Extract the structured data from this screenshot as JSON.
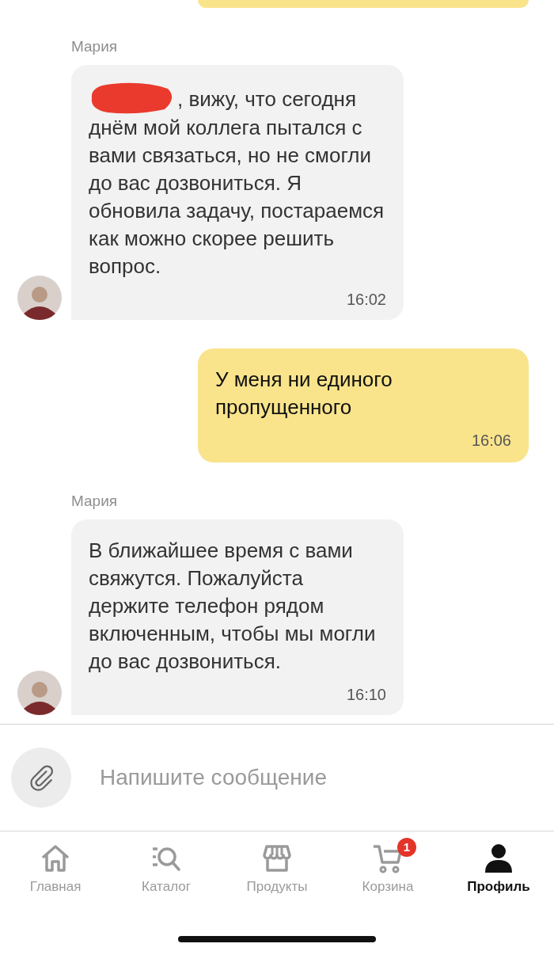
{
  "messages": [
    {
      "kind": "outgoing_cut"
    },
    {
      "kind": "incoming",
      "sender": "Мария",
      "redacted": true,
      "text": ", вижу, что сегодня днём мой коллега пытался с вами связаться, но не смогли до вас дозвониться. Я обновила задачу, постараемся как можно скорее решить вопрос.",
      "time": "16:02"
    },
    {
      "kind": "outgoing",
      "text": "У меня ни единого пропущенного",
      "time": "16:06"
    },
    {
      "kind": "incoming",
      "sender": "Мария",
      "redacted": false,
      "text": "В ближайшее время с вами свяжутся. Пожалуйста держите телефон рядом включенным, чтобы мы могли до вас дозвониться.",
      "time": "16:10"
    }
  ],
  "composer": {
    "placeholder": "Напишите сообщение"
  },
  "tabs": [
    {
      "kind": "home",
      "label": "Главная",
      "selected": false
    },
    {
      "kind": "catalog",
      "label": "Каталог",
      "selected": false
    },
    {
      "kind": "store",
      "label": "Продукты",
      "selected": false
    },
    {
      "kind": "cart",
      "label": "Корзина",
      "selected": false,
      "badge": "1"
    },
    {
      "kind": "profile",
      "label": "Профиль",
      "selected": true
    }
  ]
}
